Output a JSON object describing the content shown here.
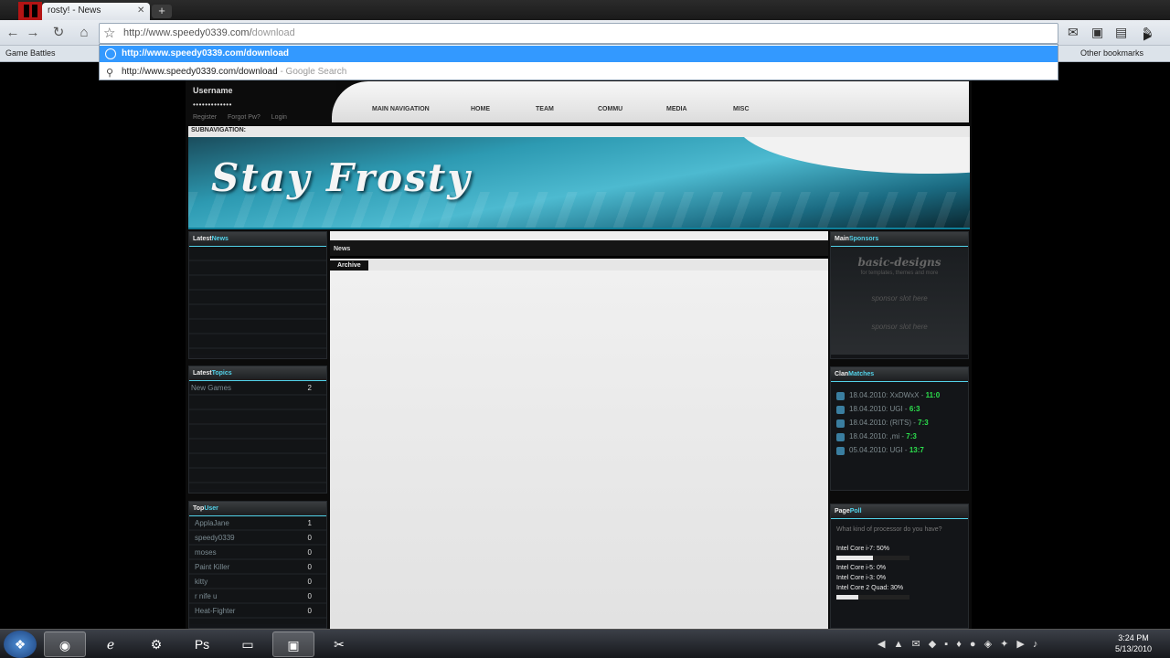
{
  "browser": {
    "tab_title": "rosty! - News",
    "new_tab": "+",
    "url_typed": "http://www.speedy0339.com/",
    "url_completion": "download",
    "url_placeholder": "",
    "bookmark_game_battles": "Game Battles",
    "bookmark_other": "Other bookmarks",
    "suggestion_1": "http://www.speedy0339.com/download",
    "suggestion_2_url": "http://www.speedy0339.com/download",
    "suggestion_2_suffix": " - Google Search"
  },
  "site": {
    "login_username": "Username",
    "login_password": "•••••••••••••",
    "login_register": "Register",
    "login_forgot": "Forgot Pw?",
    "login_login": "Login",
    "nav": [
      "MAIN NAVIGATION",
      "HOME",
      "TEAM",
      "COMMU",
      "MEDIA",
      "MISC"
    ],
    "subnav": "SUBNAVIGATION:",
    "banner_title": "Stay Frosty",
    "latest_news_head": [
      "Latest",
      "News"
    ],
    "latest_topics_head": [
      "Latest",
      "Topics"
    ],
    "latest_topics": [
      {
        "title": "New Games",
        "count": "2"
      }
    ],
    "top_user_head": [
      "Top",
      "User"
    ],
    "top_users": [
      {
        "name": "ApplaJane",
        "count": "1"
      },
      {
        "name": "speedy0339",
        "count": "0"
      },
      {
        "name": "moses",
        "count": "0"
      },
      {
        "name": "Paint Killer",
        "count": "0"
      },
      {
        "name": "kitty",
        "count": "0"
      },
      {
        "name": "r nife u",
        "count": "0"
      },
      {
        "name": "Heat-Fighter",
        "count": "0"
      }
    ],
    "news_bar": "News",
    "archive": "Archive",
    "main_sponsors_head": [
      "Main",
      "Sponsors"
    ],
    "sponsor_logo": "basic-designs",
    "sponsor_sub": "for templates, themes and more",
    "sponsor_line": "sponsor slot here",
    "clanwars_head": [
      "Clan",
      "Matches"
    ],
    "matches": [
      {
        "text": "18.04.2010: XxDWxX - ",
        "score": "11:0"
      },
      {
        "text": "18.04.2010: UGI - ",
        "score": "6:3"
      },
      {
        "text": "18.04.2010: (RITS) - ",
        "score": "7:3"
      },
      {
        "text": "18.04.2010: ,mi - ",
        "score": "7:3"
      },
      {
        "text": "05.04.2010: UGI - ",
        "score": "13:7"
      }
    ],
    "poll_head": [
      "Page",
      "Poll"
    ],
    "poll_question": "What kind of processor do you have?",
    "poll_options": [
      {
        "label": "Intel Core i-7: 50%",
        "pct": 50
      },
      {
        "label": "Intel Core i-5: 0%",
        "pct": 0
      },
      {
        "label": "Intel Core i-3: 0%",
        "pct": 0
      },
      {
        "label": "Intel Core 2 Quad: 30%",
        "pct": 30
      }
    ]
  },
  "taskbar": {
    "time": "3:24 PM",
    "date": "5/13/2010",
    "apps": [
      "chrome-icon",
      "ie-icon",
      "steam-icon",
      "photoshop-icon",
      "folder-icon",
      "desktop-icon",
      "snipping-icon"
    ]
  }
}
